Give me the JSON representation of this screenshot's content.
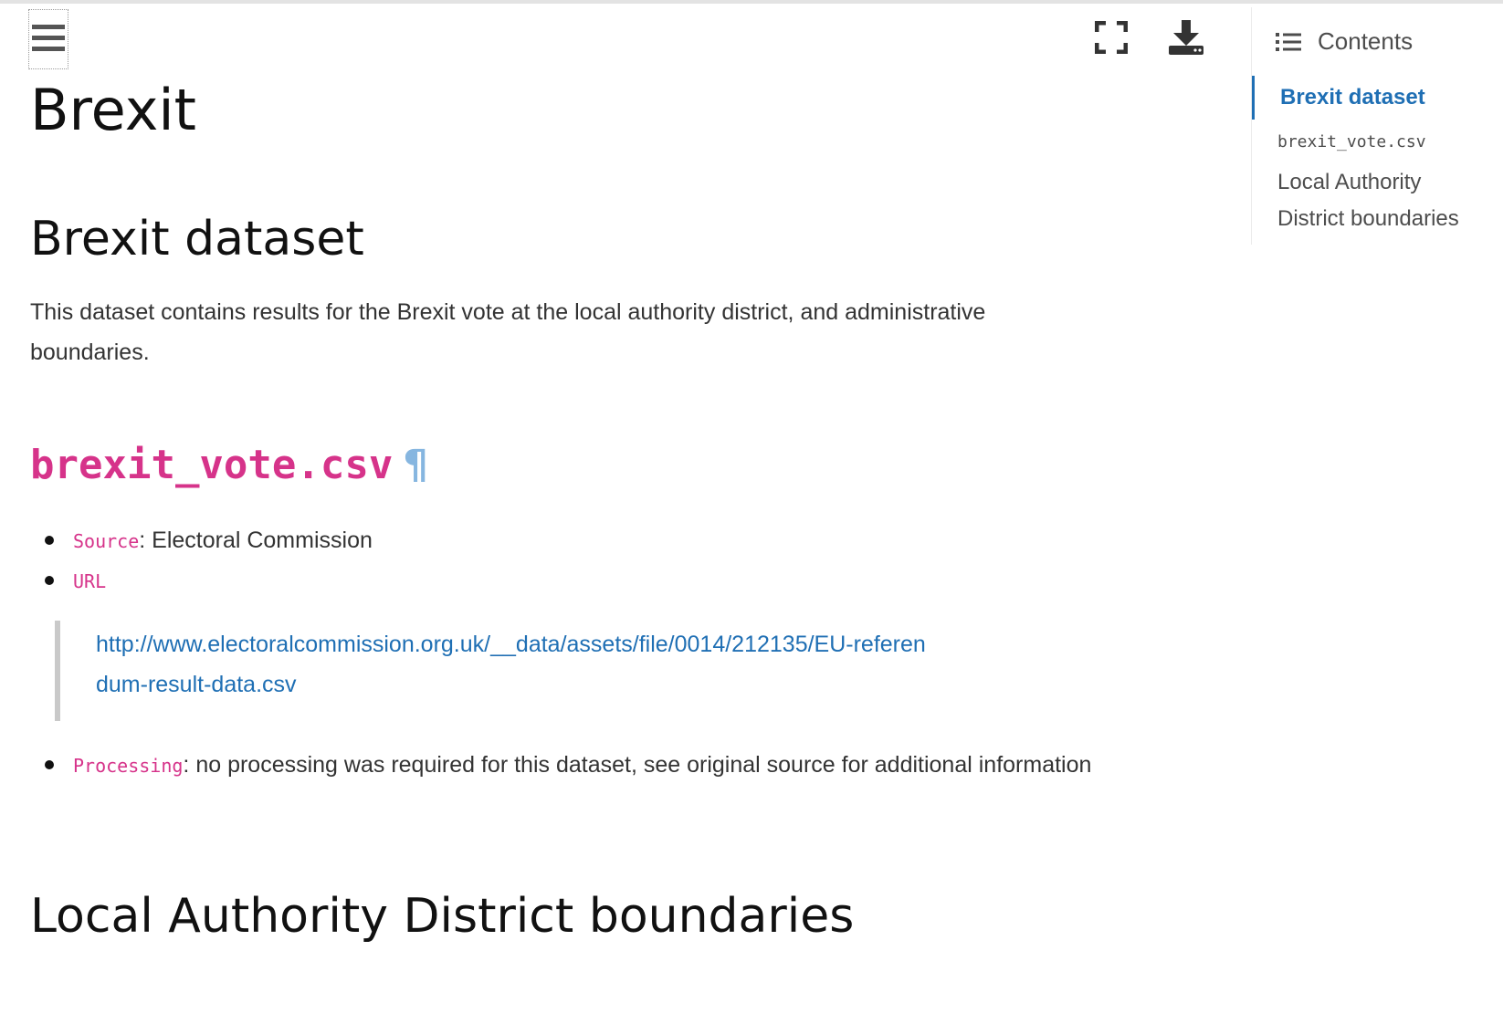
{
  "toolbar": {
    "menu_icon": "hamburger-menu-icon",
    "fullscreen_icon": "fullscreen-icon",
    "download_icon": "download-icon"
  },
  "toc": {
    "header_label": "Contents",
    "header_icon": "list-icon",
    "items": [
      {
        "label": "Brexit dataset",
        "active": true
      },
      {
        "label": "brexit_vote.csv",
        "active": false
      },
      {
        "label": "Local Authority District boundaries",
        "active": false
      }
    ]
  },
  "main": {
    "title": "Brexit",
    "section1": {
      "heading": "Brexit dataset",
      "paragraph": "This dataset contains results for the Brexit vote at the local authority district, and administrative boundaries."
    },
    "subsection": {
      "heading": "brexit_vote.csv",
      "anchor": "¶",
      "bullets": {
        "source_key": "Source",
        "source_value": ": Electoral Commission",
        "url_key": "URL",
        "url_link": "http://www.electoralcommission.org.uk/__data/assets/file/0014/212135/EU-referendum-result-data.csv",
        "processing_key": "Processing",
        "processing_value": ": no processing was required for this dataset, see original source for additional information"
      }
    },
    "section2": {
      "heading": "Local Authority District boundaries"
    }
  },
  "colors": {
    "link": "#1f6fb4",
    "code": "#d6338a",
    "anchor": "#86b6e0"
  }
}
